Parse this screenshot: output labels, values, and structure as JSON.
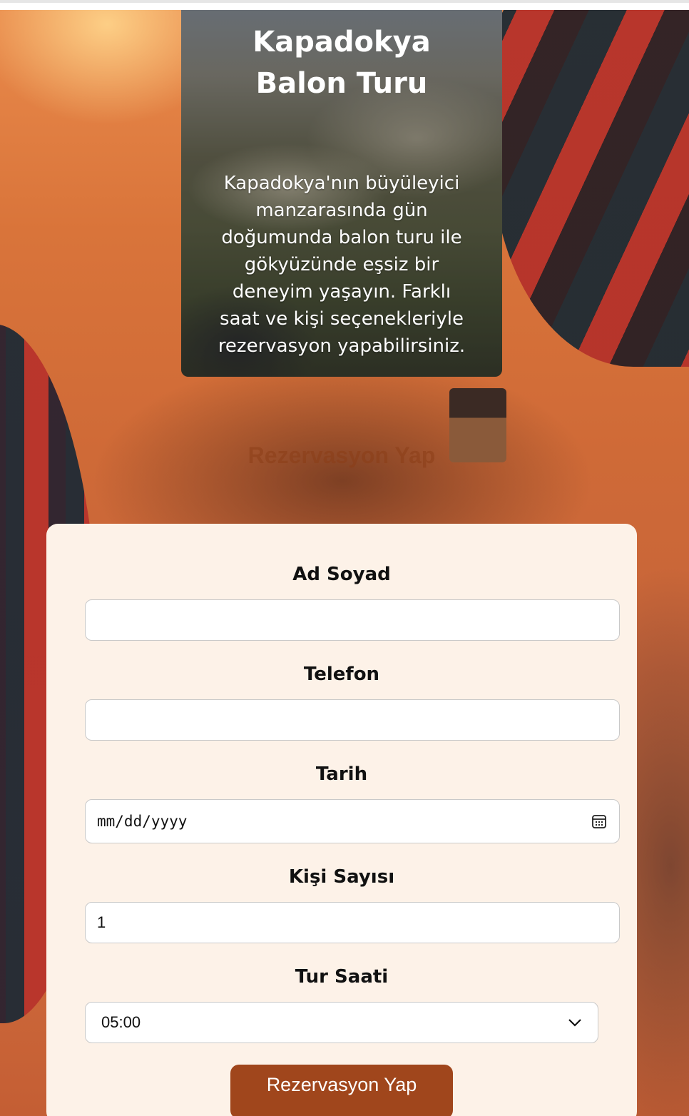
{
  "hero": {
    "title": "Kapadokya Balon Turu",
    "description": "Kapadokya'nın büyüleyici manzarasında gün doğumunda balon turu ile gökyüzünde eşsiz bir deneyim yaşayın. Farklı saat ve kişi seçenekleriyle rezervasyon yapabilirsiniz."
  },
  "reservation": {
    "heading": "Rezervasyon Yap",
    "fields": {
      "name_label": "Ad Soyad",
      "name_value": "",
      "phone_label": "Telefon",
      "phone_value": "",
      "date_label": "Tarih",
      "date_placeholder": "mm/dd/yyyy",
      "people_label": "Kişi Sayısı",
      "people_value": "1",
      "time_label": "Tur Saati",
      "time_selected": "05:00"
    },
    "submit_label": "Rezervasyon Yap"
  },
  "icons": {
    "date": "calendar-icon",
    "select": "chevron-down-icon"
  },
  "colors": {
    "accent": "#a0461c",
    "card_background": "#fdf2e8",
    "heading": "#8b3d16"
  }
}
